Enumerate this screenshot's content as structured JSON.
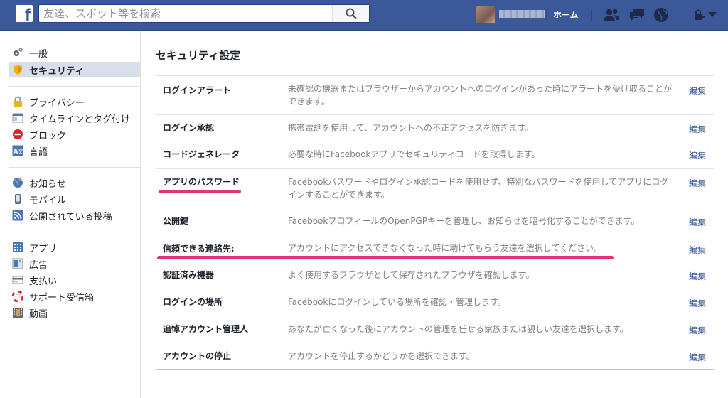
{
  "header": {
    "logo": "f",
    "search_placeholder": "友達、スポット等を検索",
    "home_label": "ホーム",
    "icons": [
      "search-icon",
      "friends-icon",
      "messages-icon",
      "globe-icon",
      "lock-icon",
      "chevron-down-icon"
    ]
  },
  "sidebar": {
    "groups": [
      [
        {
          "label": "一般",
          "icon": "gear-icon"
        },
        {
          "label": "セキュリティ",
          "icon": "shield-icon",
          "active": true
        }
      ],
      [
        {
          "label": "プライバシー",
          "icon": "lock-icon"
        },
        {
          "label": "タイムラインとタグ付け",
          "icon": "timeline-icon"
        },
        {
          "label": "ブロック",
          "icon": "block-icon"
        },
        {
          "label": "言語",
          "icon": "language-icon"
        }
      ],
      [
        {
          "label": "お知らせ",
          "icon": "globe-icon"
        },
        {
          "label": "モバイル",
          "icon": "mobile-icon"
        },
        {
          "label": "公開されている投稿",
          "icon": "rss-icon"
        }
      ],
      [
        {
          "label": "アプリ",
          "icon": "apps-icon"
        },
        {
          "label": "広告",
          "icon": "ads-icon"
        },
        {
          "label": "支払い",
          "icon": "payments-icon"
        },
        {
          "label": "サポート受信箱",
          "icon": "support-icon"
        },
        {
          "label": "動画",
          "icon": "video-icon"
        }
      ]
    ]
  },
  "main": {
    "title": "セキュリティ設定",
    "edit_label": "編集",
    "rows": [
      {
        "label": "ログインアラート",
        "desc": "未確認の機器またはブラウザーからアカウントへのログインがあった時にアラートを受け取ることができます。"
      },
      {
        "label": "ログイン承認",
        "desc": "携帯電話を使用して、アカウントへの不正アクセスを防ぎます。"
      },
      {
        "label": "コードジェネレータ",
        "desc": "必要な時にFacebookアプリでセキュリティコードを取得します。"
      },
      {
        "label": "アプリのパスワード",
        "desc": "Facebookパスワードやログイン承認コードを使用せず、特別なパスワードを使用してアプリにログインすることができます。"
      },
      {
        "label": "公開鍵",
        "desc": "FacebookプロフィールのOpenPGPキーを管理し、お知らせを暗号化することができます。"
      },
      {
        "label": "信頼できる連絡先:",
        "desc": "アカウントにアクセスできなくなった時に助けてもらう友達を選択してください。"
      },
      {
        "label": "認証済み機器",
        "desc": "よく使用するブラウザとして保存されたブラウザを確認します。"
      },
      {
        "label": "ログインの場所",
        "desc": "Facebookにログインしている場所を確認・管理します。"
      },
      {
        "label": "追悼アカウント管理人",
        "desc": "あなたが亡くなった後にアカウントの管理を任せる家族または親しい友達を選択します。"
      },
      {
        "label": "アカウントの停止",
        "desc": "アカウントを停止するかどうかを選択できます。"
      }
    ]
  },
  "colors": {
    "brand": "#3b5998",
    "link": "#365899",
    "highlight": "#e8307a",
    "active_bg": "#d8dfea"
  }
}
